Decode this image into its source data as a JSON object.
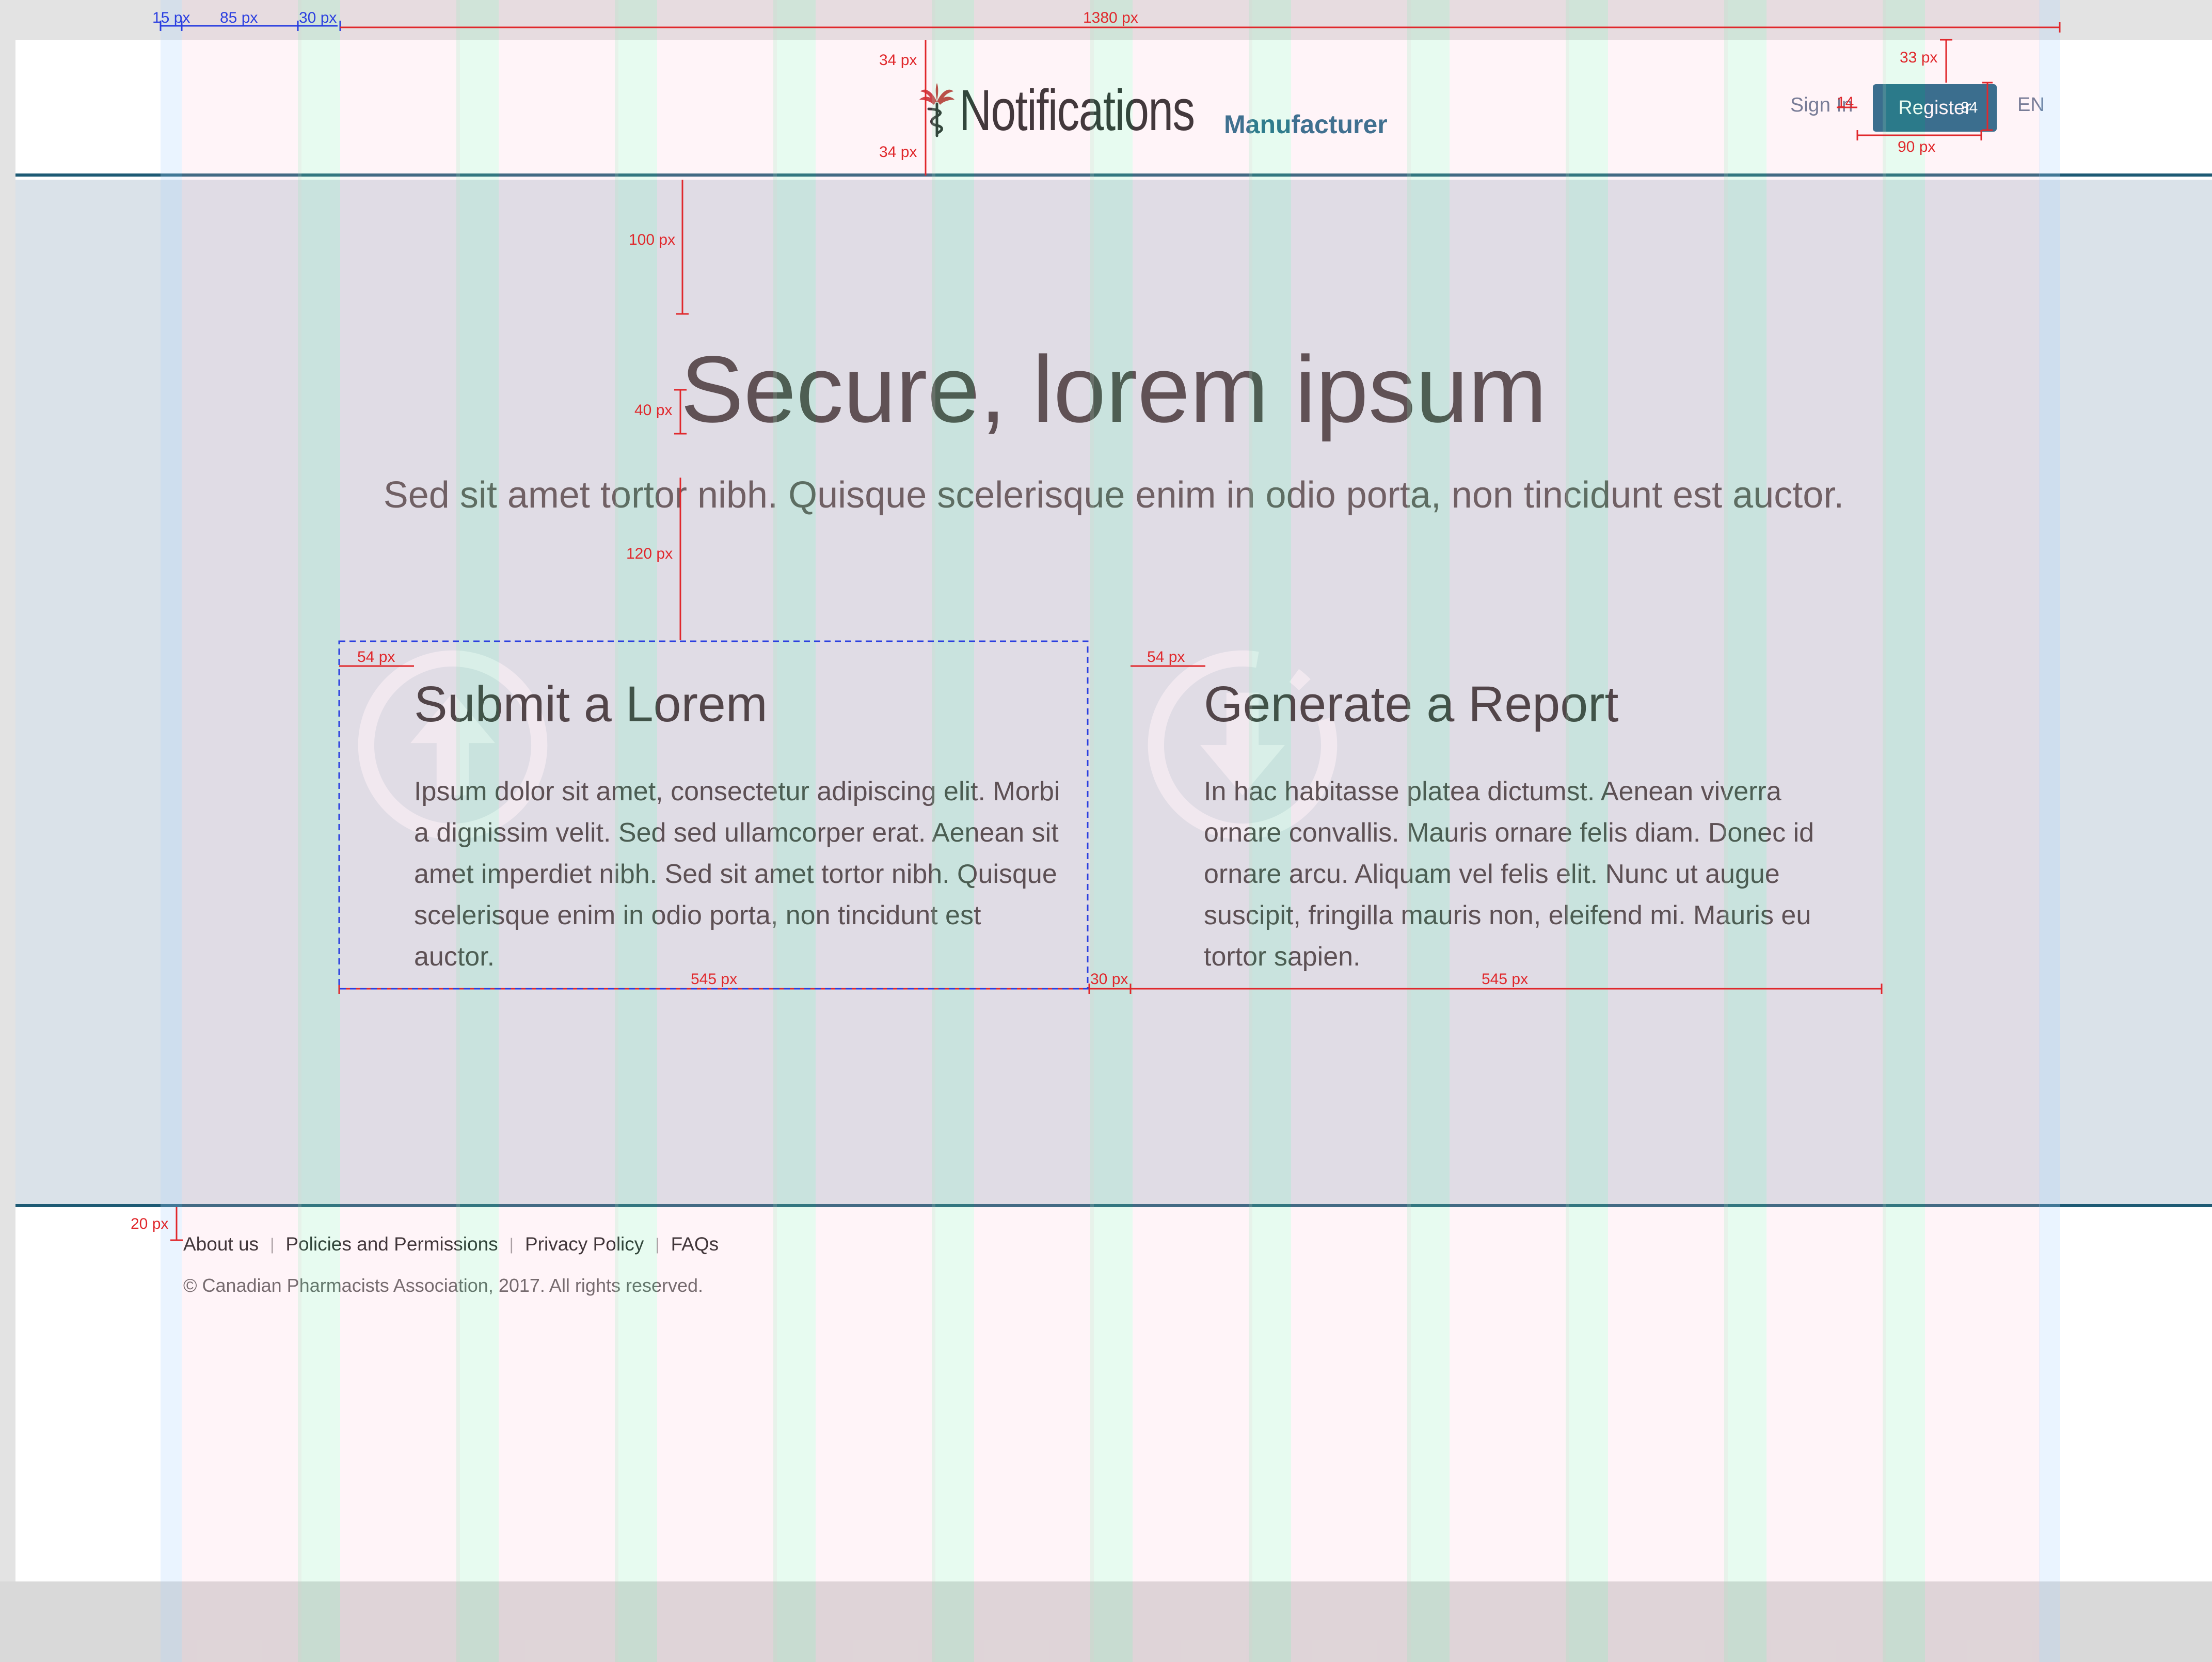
{
  "header": {
    "brand_title": "Notifications",
    "brand_subtitle": "Manufacturer",
    "sign_in": "Sign In",
    "register": "Register",
    "language": "EN"
  },
  "hero": {
    "headline": "Secure, lorem ipsum",
    "tagline": "Sed sit amet tortor nibh. Quisque scelerisque enim in odio porta, non tincidunt est auctor."
  },
  "cards": [
    {
      "title": "Submit a Lorem",
      "body": "Ipsum dolor sit amet, consectetur adipiscing elit. Morbi a dignissim velit. Sed sed ullamcorper erat. Aenean sit amet imperdiet nibh. Sed sit amet tortor nibh. Quisque scelerisque enim in odio porta, non tincidunt est auctor.",
      "icon": "upload-icon"
    },
    {
      "title": "Generate a Report",
      "body": "In hac habitasse platea dictumst. Aenean viverra ornare convallis. Mauris ornare felis diam. Donec id ornare arcu. Aliquam vel felis elit. Nunc ut augue suscipit, fringilla mauris non, eleifend mi. Mauris eu tortor sapien.",
      "icon": "download-icon"
    }
  ],
  "footer": {
    "links": [
      "About us",
      "Policies and Permissions",
      "Privacy Policy",
      "FAQs"
    ],
    "copyright": "© Canadian Pharmacists Association, 2017. All rights reserved."
  },
  "annotations": {
    "grid_gutter": "15 px",
    "grid_column": "85 px",
    "grid_gap": "30 px",
    "container_width": "1380 px",
    "logo_top_spacing": "34 px",
    "logo_bottom_spacing": "34 px",
    "register_top_spacing": "33 px",
    "register_gap": "14",
    "register_height": "34",
    "register_width": "90 px",
    "headline_top_spacing": "100 px",
    "headline_tagline_spacing": "40 px",
    "tagline_cards_spacing": "120 px",
    "card_left_padding": "54 px",
    "card_right_left_padding": "54 px",
    "card_width": "545 px",
    "cards_gap": "30 px",
    "card_right_width": "545 px",
    "footer_top_spacing": "20 px"
  },
  "colors": {
    "primary": "#145e80",
    "brand_dark": "#1d5a74",
    "hero_background": "#dae2e9",
    "annotation_red": "#e0282c",
    "annotation_blue": "#2b3fe0"
  }
}
